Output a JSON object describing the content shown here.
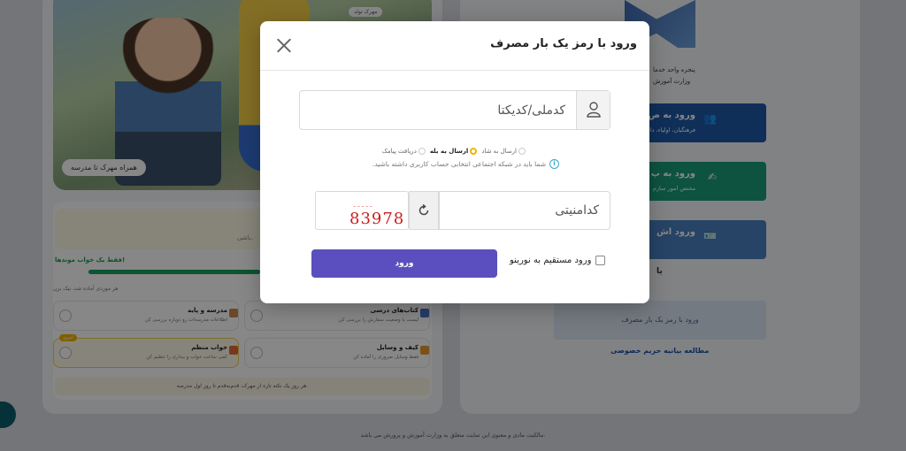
{
  "background": {
    "hero": {
      "tag": "همراه مهرک تا مدرسه",
      "top_tag": "مهرک تولد"
    },
    "plan": {
      "inner_text": "باشی.",
      "progress_label": "فقط یک خواب موندها!",
      "progress_sub": "هر موردی آماده شد، تیک بزن",
      "tasks": [
        {
          "title": "مدرسه و پایه",
          "desc": "اطلاعات مدرسه‌ات رو دوباره بررسی کن",
          "badge": ""
        },
        {
          "title": "کتاب‌های درسی",
          "desc": "لیست یا وضعیت سفارش را بررسی کن",
          "badge": ""
        },
        {
          "title": "خواب منظم",
          "desc": "کمی ساعت خواب و بیداری را تنظیم کن",
          "badge": "امروز"
        },
        {
          "title": "کیف و وسایل",
          "desc": "فقط وسایل ضروری را آماده کن",
          "badge": ""
        }
      ],
      "tip": "هر روز یک نکته تازه از مهرک، قدم‌به‌قدم تا روز اول مدرسه."
    },
    "right": {
      "title_lines": [
        "پنجره واحد خدما",
        "وزارت آموزش"
      ],
      "btn1": {
        "l1": "ورود به ص",
        "l2": "فرهنگیان، اولیاء، دانش",
        "color": "#1e5aa8"
      },
      "btn2": {
        "l1": "ورود به پ",
        "l2": "مختص امور سازم",
        "color": "#1a9e77"
      },
      "btn3": {
        "l1": "ورود اش",
        "color": "#4a7fc0"
      },
      "ya": "یا",
      "otp_side": "ورود با رمز یک بار مصرف",
      "privacy": "مطالعه بیانیه حریم خصوصی"
    },
    "footer": "مالکیت مادی و معنوی این سایت متعلق به وزارت آموزش و پرورش می باشد."
  },
  "modal": {
    "title": "ورود با رمز یک بار مصرف",
    "username_placeholder": "کدملی/کدیکتا",
    "send_options": [
      "ارسال به شاد",
      "ارسال به بله",
      "دریافت پیامک"
    ],
    "info": "شما باید در شبکه اجتماعی انتخابی حساب کاربری داشته باشید.",
    "captcha_text": "83978",
    "captcha_placeholder": "کدامنیتی",
    "login_label": "ورود",
    "direct_label": "ورود مستقیم به نورینو"
  }
}
